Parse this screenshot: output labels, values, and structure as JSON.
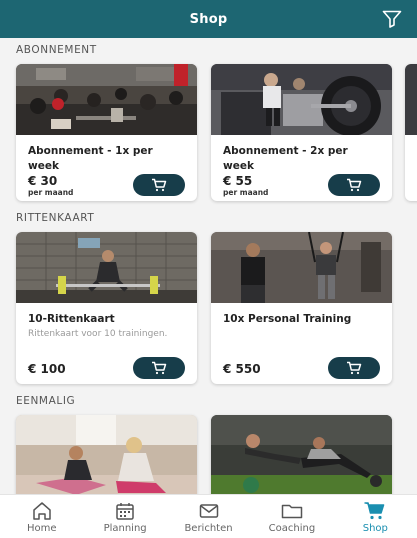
{
  "header": {
    "title": "Shop",
    "filter_icon": "filter-icon"
  },
  "sections": [
    {
      "title": "ABONNEMENT",
      "cards": [
        {
          "name": "Abonnement - 1x per week",
          "price": "€ 30",
          "unit": "per maand"
        },
        {
          "name": "Abonnement - 2x per week",
          "price": "€ 55",
          "unit": "per maand"
        }
      ]
    },
    {
      "title": "RITTENKAART",
      "cards": [
        {
          "name": "10-Rittenkaart",
          "description": "Rittenkaart voor 10 trainingen.",
          "price": "€ 100"
        },
        {
          "name": "10x Personal Training",
          "price": "€ 550"
        }
      ]
    },
    {
      "title": "EENMALIG",
      "cards": [
        {},
        {}
      ]
    }
  ],
  "nav": {
    "items": [
      {
        "label": "Home",
        "icon": "home-icon"
      },
      {
        "label": "Planning",
        "icon": "calendar-icon"
      },
      {
        "label": "Berichten",
        "icon": "mail-icon"
      },
      {
        "label": "Coaching",
        "icon": "folder-icon"
      },
      {
        "label": "Shop",
        "icon": "cart-icon",
        "active": true
      }
    ]
  },
  "colors": {
    "header": "#1d6672",
    "cart_button": "#173d4a",
    "active_nav": "#1a8fb0"
  }
}
